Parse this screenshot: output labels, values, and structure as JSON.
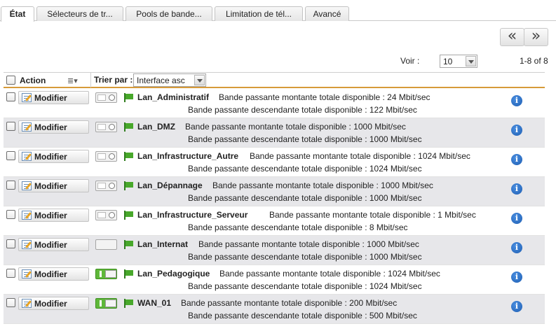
{
  "tabs": [
    {
      "label": "État",
      "active": true
    },
    {
      "label": "Sélecteurs de tr...",
      "active": false
    },
    {
      "label": "Pools de bande...",
      "active": false
    },
    {
      "label": "Limitation de tél...",
      "active": false
    },
    {
      "label": "Avancé",
      "active": false
    }
  ],
  "pager": {
    "prev_symbol": "«",
    "next_symbol": "»",
    "voir_label": "Voir :",
    "page_size": "10",
    "range_text": "1-8 of 8"
  },
  "table": {
    "action_header": "Action",
    "menu_symbol": "≣▾",
    "sort_label": "Trier par :",
    "sort_value": "Interface asc",
    "modify_label": "Modifier",
    "info_symbol": "i",
    "rows": [
      {
        "name": "Lan_Administratif",
        "toggle": "off",
        "up": "Bande passante montante totale disponible : 24 Mbit/sec",
        "down": "Bande passante descendante totale disponible : 122 Mbit/sec"
      },
      {
        "name": "Lan_DMZ",
        "toggle": "off",
        "up": "Bande passante montante totale disponible : 1000 Mbit/sec",
        "down": "Bande passante descendante totale disponible : 1000 Mbit/sec"
      },
      {
        "name": "Lan_Infrastructure_Autre",
        "toggle": "off",
        "up": "Bande passante montante totale disponible : 1024 Mbit/sec",
        "down": "Bande passante descendante totale disponible : 1024 Mbit/sec"
      },
      {
        "name": "Lan_Dépannage",
        "toggle": "off",
        "up": "Bande passante montante totale disponible : 1000 Mbit/sec",
        "down": "Bande passante descendante totale disponible : 1000 Mbit/sec"
      },
      {
        "name": "Lan_Infrastructure_Serveur",
        "toggle": "off",
        "up": "Bande passante montante totale disponible : 1 Mbit/sec",
        "down": "Bande passante descendante totale disponible : 8 Mbit/sec"
      },
      {
        "name": "Lan_Internat",
        "toggle": "plain",
        "up": "Bande passante montante totale disponible : 1000 Mbit/sec",
        "down": "Bande passante descendante totale disponible : 1000 Mbit/sec"
      },
      {
        "name": "Lan_Pedagogique",
        "toggle": "on",
        "up": "Bande passante montante totale disponible : 1024 Mbit/sec",
        "down": "Bande passante descendante totale disponible : 1024 Mbit/sec"
      },
      {
        "name": "WAN_01",
        "toggle": "on",
        "up": "Bande passante montante totale disponible : 200 Mbit/sec",
        "down": "Bande passante descendante totale disponible : 500 Mbit/sec"
      }
    ]
  }
}
